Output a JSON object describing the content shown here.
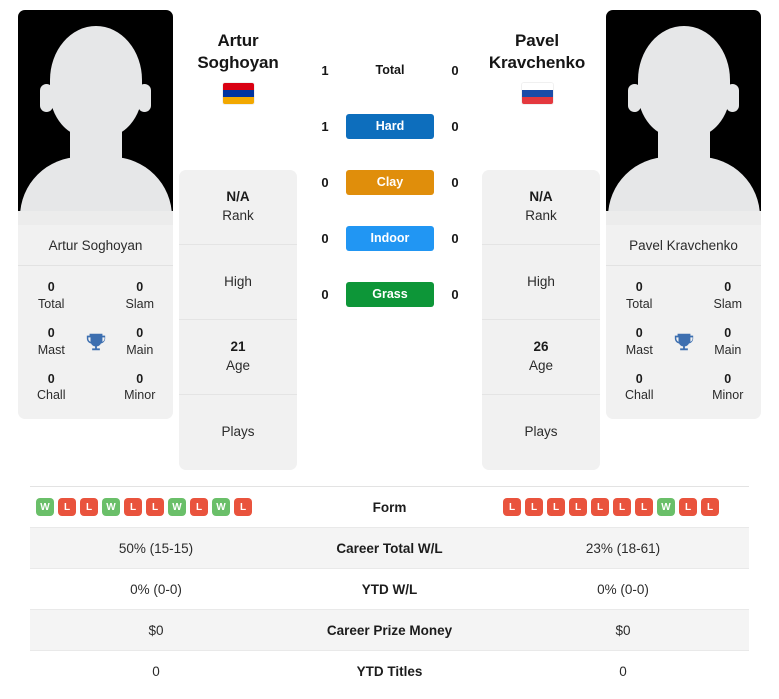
{
  "players": {
    "left": {
      "first_name": "Artur",
      "last_name": "Soghoyan",
      "full_name": "Artur Soghoyan",
      "flag_name": "armenia-flag",
      "flag_colors": [
        "#d90012",
        "#0033a0",
        "#f2a800"
      ],
      "titles": {
        "total": "0",
        "total_label": "Total",
        "slam": "0",
        "slam_label": "Slam",
        "mast": "0",
        "mast_label": "Mast",
        "main": "0",
        "main_label": "Main",
        "chall": "0",
        "chall_label": "Chall",
        "minor": "0",
        "minor_label": "Minor"
      },
      "info": {
        "rank_value": "N/A",
        "rank_label": "Rank",
        "high_value": "",
        "high_label": "High",
        "age_value": "21",
        "age_label": "Age",
        "plays_value": "",
        "plays_label": "Plays"
      }
    },
    "right": {
      "first_name": "Pavel",
      "last_name": "Kravchenko",
      "full_name": "Pavel Kravchenko",
      "flag_name": "russia-flag",
      "flag_colors": [
        "#ffffff",
        "#1b4ca8",
        "#e4383e"
      ],
      "titles": {
        "total": "0",
        "total_label": "Total",
        "slam": "0",
        "slam_label": "Slam",
        "mast": "0",
        "mast_label": "Mast",
        "main": "0",
        "main_label": "Main",
        "chall": "0",
        "chall_label": "Chall",
        "minor": "0",
        "minor_label": "Minor"
      },
      "info": {
        "rank_value": "N/A",
        "rank_label": "Rank",
        "high_value": "",
        "high_label": "High",
        "age_value": "26",
        "age_label": "Age",
        "plays_value": "",
        "plays_label": "Plays"
      }
    }
  },
  "h2h": {
    "rows": [
      {
        "left": "1",
        "label": "Total",
        "right": "0",
        "color": "transparent",
        "style": "plain"
      },
      {
        "left": "1",
        "label": "Hard",
        "right": "0",
        "color": "#0d6ebd",
        "style": "pill"
      },
      {
        "left": "0",
        "label": "Clay",
        "right": "0",
        "color": "#e08e0b",
        "style": "pill"
      },
      {
        "left": "0",
        "label": "Indoor",
        "right": "0",
        "color": "#2196f3",
        "style": "pill"
      },
      {
        "left": "0",
        "label": "Grass",
        "right": "0",
        "color": "#0d9638",
        "style": "pill"
      }
    ]
  },
  "stats_table": {
    "form_label": "Form",
    "form_left": [
      "W",
      "L",
      "L",
      "W",
      "L",
      "L",
      "W",
      "L",
      "W",
      "L"
    ],
    "form_right": [
      "L",
      "L",
      "L",
      "L",
      "L",
      "L",
      "L",
      "W",
      "L",
      "L"
    ],
    "win_color": "#6abf69",
    "loss_color": "#e9533d",
    "rows": [
      {
        "left": "50% (15-15)",
        "label": "Career Total W/L",
        "right": "23% (18-61)"
      },
      {
        "left": "0% (0-0)",
        "label": "YTD W/L",
        "right": "0% (0-0)"
      },
      {
        "left": "$0",
        "label": "Career Prize Money",
        "right": "$0"
      },
      {
        "left": "0",
        "label": "YTD Titles",
        "right": "0"
      }
    ]
  }
}
